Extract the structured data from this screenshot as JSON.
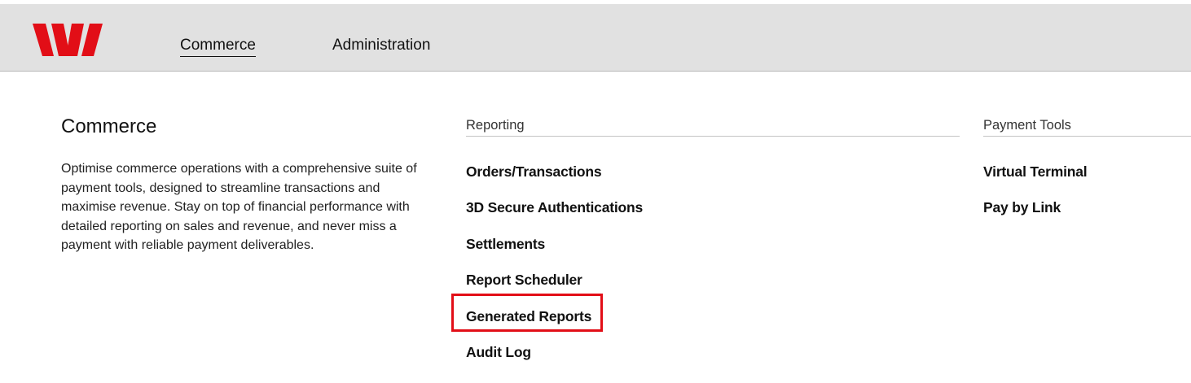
{
  "brand": {
    "logo_icon": "westpac-w-logo-icon",
    "logo_color": "#e20e17"
  },
  "nav": {
    "tabs": [
      {
        "label": "Commerce",
        "active": true
      },
      {
        "label": "Administration",
        "active": false
      }
    ]
  },
  "intro": {
    "title": "Commerce",
    "description": "Optimise commerce operations with a comprehensive suite of payment tools, designed to streamline transactions and maximise revenue. Stay on top of financial performance with detailed reporting on sales and revenue, and never miss a payment with reliable payment deliverables."
  },
  "reporting": {
    "heading": "Reporting",
    "items": [
      {
        "label": "Orders/Transactions"
      },
      {
        "label": "3D Secure Authentications"
      },
      {
        "label": "Settlements"
      },
      {
        "label": "Report Scheduler"
      },
      {
        "label": "Generated Reports",
        "highlighted": true
      },
      {
        "label": "Audit Log"
      }
    ]
  },
  "payment_tools": {
    "heading": "Payment Tools",
    "items": [
      {
        "label": "Virtual Terminal"
      },
      {
        "label": "Pay by Link"
      }
    ]
  },
  "colors": {
    "header_bg": "#e1e1e1",
    "highlight": "#e20e17"
  }
}
